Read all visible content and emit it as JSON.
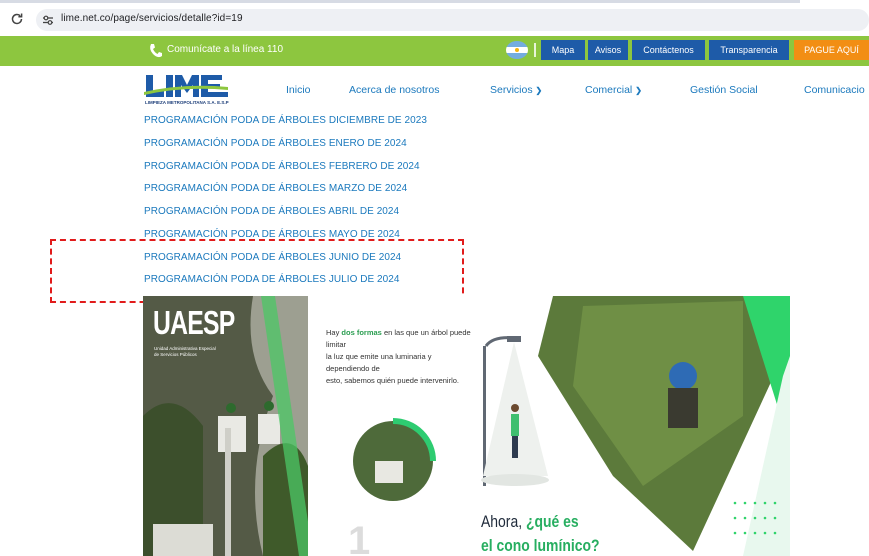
{
  "browser": {
    "url": "lime.net.co/page/servicios/detalle?id=19"
  },
  "topbar": {
    "phone_text": "Comunícate a la línea 110",
    "buttons": [
      "Mapa",
      "Avisos",
      "Contáctenos",
      "Transparencia",
      "PAGUE AQUÍ"
    ]
  },
  "logo": {
    "name": "LIME",
    "tagline": "LIMPIEZA METROPOLITANA S.A. E.S.P"
  },
  "nav": {
    "items": [
      "Inicio",
      "Acerca de nosotros",
      "Servicios",
      "Comercial",
      "Gestión Social",
      "Comunicacio"
    ]
  },
  "dropdown": {
    "items": [
      "PROGRAMACIÓN PODA DE ÁRBOLES DICIEMBRE DE 2023",
      "PROGRAMACIÓN PODA DE ÁRBOLES ENERO DE 2024",
      "PROGRAMACIÓN PODA DE ÁRBOLES FEBRERO DE 2024",
      "PROGRAMACIÓN PODA DE ÁRBOLES MARZO DE 2024",
      "PROGRAMACIÓN PODA DE ÁRBOLES ABRIL DE 2024",
      "PROGRAMACIÓN PODA DE ÁRBOLES MAYO DE 2024",
      "PROGRAMACIÓN PODA DE ÁRBOLES JUNIO DE 2024",
      "PROGRAMACIÓN PODA DE ÁRBOLES JULIO DE 2024"
    ]
  },
  "infographic": {
    "agency": "UAESP",
    "agency_sub1": "Unidad Administrativa Especial",
    "agency_sub2": "de Servicios Públicos",
    "para_pre": "Hay ",
    "para_em": "dos formas",
    "para_post": " en las que un árbol puede limitar",
    "para_line2": "la luz que emite una luminaria y dependiendo de",
    "para_line3": "esto, sabemos quién puede intervenirlo.",
    "ahora": "Ahora, ",
    "que_es": "¿qué es",
    "cono": "el cono lumínico?"
  },
  "colors": {
    "green": "#8dc63f",
    "blue_button": "#1e5ba8",
    "orange_button": "#f28e14",
    "link_blue": "#1b79bd",
    "highlight_dash": "#e11b1b"
  }
}
